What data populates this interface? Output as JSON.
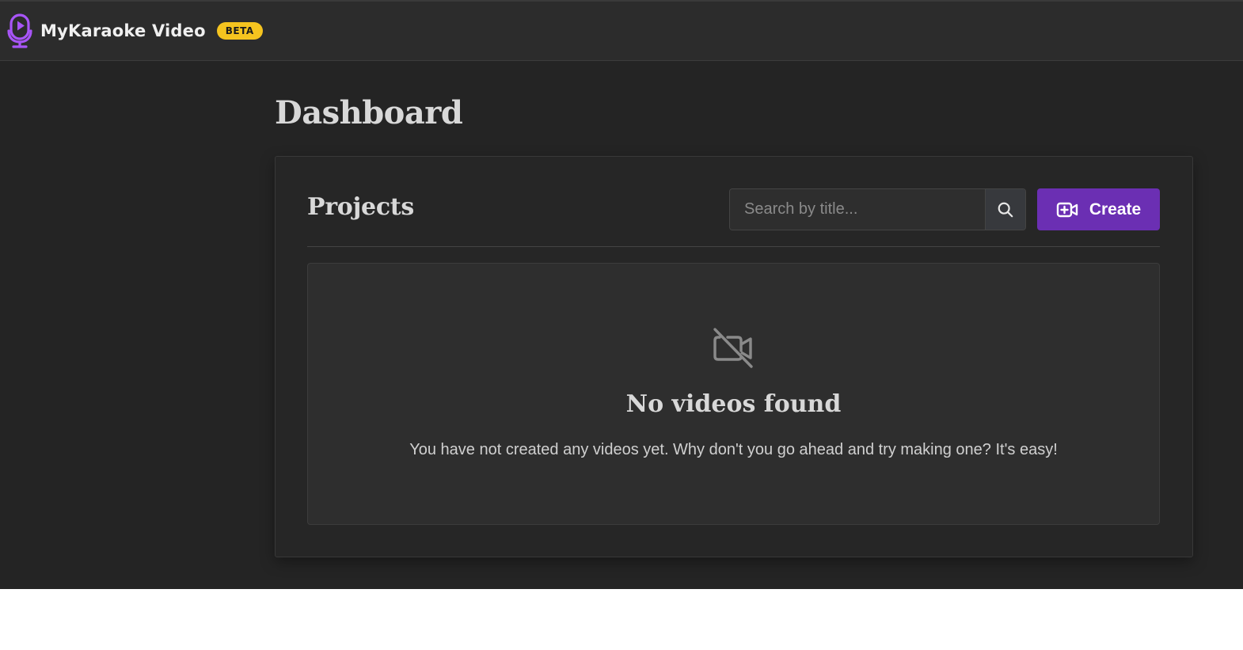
{
  "app": {
    "name": "MyKaraoke Video",
    "badge": "BETA"
  },
  "page": {
    "title": "Dashboard"
  },
  "projects": {
    "title": "Projects",
    "search": {
      "placeholder": "Search by title...",
      "value": ""
    },
    "create_label": "Create",
    "empty_state": {
      "title": "No videos found",
      "message": "You have not created any videos yet. Why don't you go ahead and try making one? It's easy!"
    }
  },
  "icons": {
    "logo": "microphone-play-icon",
    "search": "search-icon",
    "create": "video-plus-icon",
    "empty": "video-off-icon"
  },
  "colors": {
    "accent": "#6b2fb3",
    "logo": "#a855f7",
    "badge": "#f5c41f",
    "background": "#242424",
    "navbar": "#2c2c2c"
  }
}
